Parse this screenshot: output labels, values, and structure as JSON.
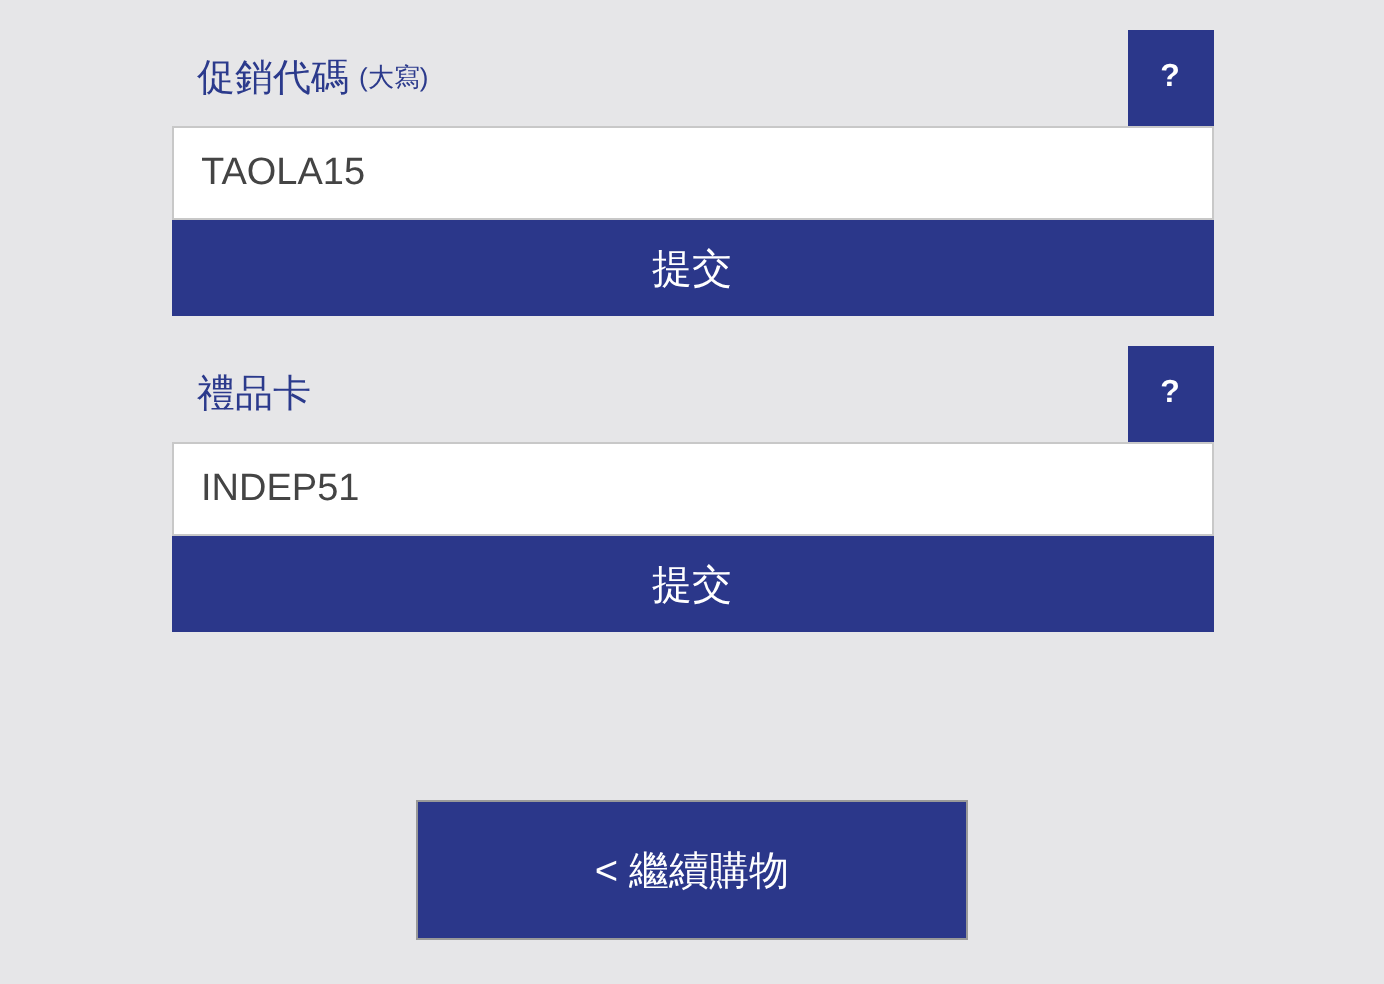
{
  "sections": [
    {
      "label": "促銷代碼",
      "note": "(大寫)",
      "help": "?",
      "value": "TAOLA15",
      "submit": "提交"
    },
    {
      "label": "禮品卡",
      "help": "?",
      "value": "INDEP51",
      "submit": "提交"
    }
  ],
  "continue_button": "< 繼續購物"
}
